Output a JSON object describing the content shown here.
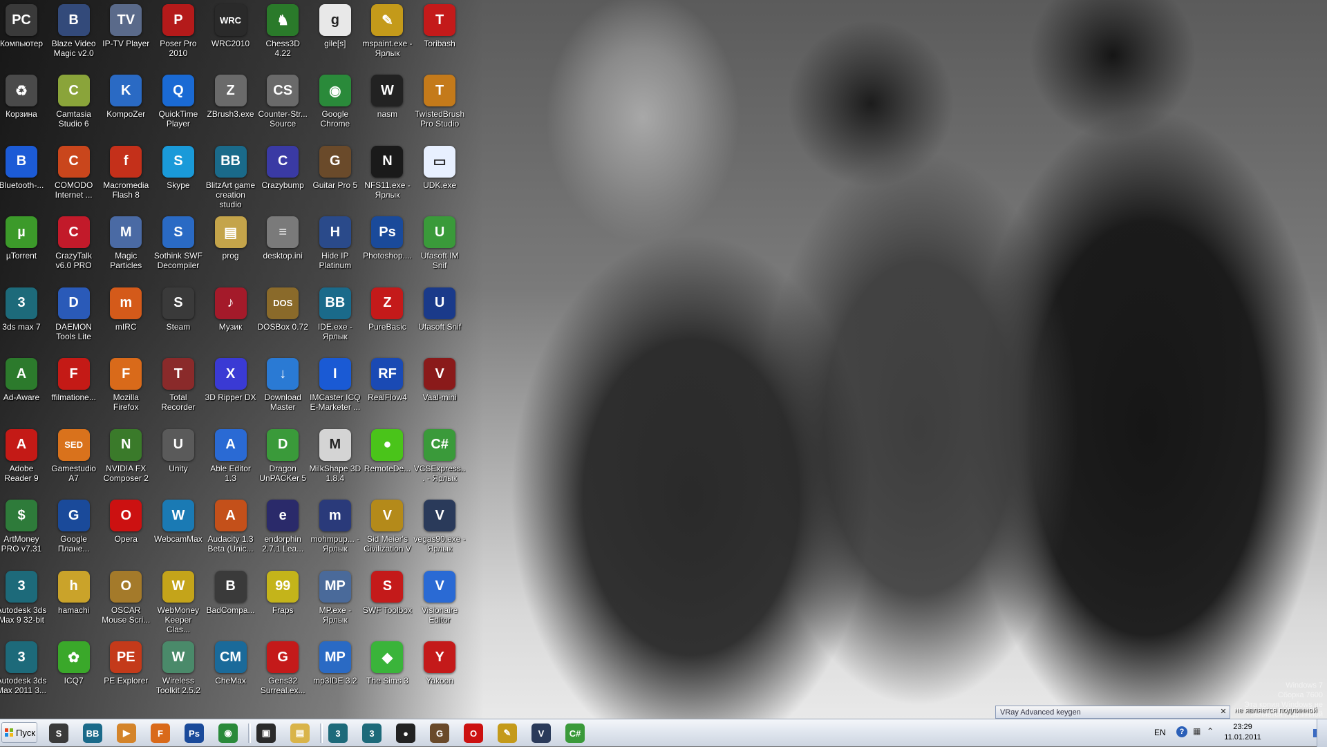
{
  "watermark": [
    "Windows 7",
    "Сборка 7600",
    "Эта копия Windows не является подлинной"
  ],
  "desktop_icons": [
    {
      "label": "Компьютер",
      "color": "#3a3a3a",
      "glyph": "PC"
    },
    {
      "label": "Корзина",
      "color": "#4a4a4a",
      "glyph": "♻"
    },
    {
      "label": "Bluetooth-...",
      "color": "#1c5bd6",
      "glyph": "B"
    },
    {
      "label": "µTorrent",
      "color": "#3c9a2a",
      "glyph": "µ"
    },
    {
      "label": "3ds max 7",
      "color": "#1d6a7a",
      "glyph": "3"
    },
    {
      "label": "Ad-Aware",
      "color": "#2c7a2c",
      "glyph": "A"
    },
    {
      "label": "Adobe Reader 9",
      "color": "#c41a16",
      "glyph": "A"
    },
    {
      "label": "ArtMoney PRO v7.31",
      "color": "#2e7b3a",
      "glyph": "$"
    },
    {
      "label": "Autodesk 3ds Max 9 32-bit",
      "color": "#1d6a7a",
      "glyph": "3"
    },
    {
      "label": "Autodesk 3ds Max 2011 3...",
      "color": "#1d6a7a",
      "glyph": "3"
    },
    {
      "label": "Blaze Video Magic v2.0",
      "color": "#334a7a",
      "glyph": "B"
    },
    {
      "label": "Camtasia Studio 6",
      "color": "#8aa43a",
      "glyph": "C"
    },
    {
      "label": "COMODO Internet ...",
      "color": "#c9461c",
      "glyph": "C"
    },
    {
      "label": "CrazyTalk v6.0 PRO",
      "color": "#c21a2a",
      "glyph": "C"
    },
    {
      "label": "DAEMON Tools Lite",
      "color": "#2a5ab8",
      "glyph": "D"
    },
    {
      "label": "ffilmatione...",
      "color": "#c41a16",
      "glyph": "F"
    },
    {
      "label": "Gamestudio A7",
      "color": "#d9721c",
      "glyph": "SED"
    },
    {
      "label": "Google Плане...",
      "color": "#1a4a9a",
      "glyph": "G"
    },
    {
      "label": "hamachi",
      "color": "#caa32a",
      "glyph": "h"
    },
    {
      "label": "ICQ7",
      "color": "#3aa82a",
      "glyph": "✿"
    },
    {
      "label": "IP-TV Player",
      "color": "#5a6a8a",
      "glyph": "TV"
    },
    {
      "label": "KompoZer",
      "color": "#2a6ac4",
      "glyph": "K"
    },
    {
      "label": "Macromedia Flash 8",
      "color": "#c4301a",
      "glyph": "f"
    },
    {
      "label": "Magic Particles",
      "color": "#4a6aa4",
      "glyph": "M"
    },
    {
      "label": "mIRC",
      "color": "#d45a1a",
      "glyph": "m"
    },
    {
      "label": "Mozilla Firefox",
      "color": "#d96a1a",
      "glyph": "F"
    },
    {
      "label": "NVIDIA FX Composer 2",
      "color": "#3a7a2a",
      "glyph": "N"
    },
    {
      "label": "Opera",
      "color": "#cc1111",
      "glyph": "O"
    },
    {
      "label": "OSCAR Mouse Scri...",
      "color": "#a47a2a",
      "glyph": "O"
    },
    {
      "label": "PE Explorer",
      "color": "#c43a1a",
      "glyph": "PE"
    },
    {
      "label": "Poser Pro 2010",
      "color": "#b41a1a",
      "glyph": "P"
    },
    {
      "label": "QuickTime Player",
      "color": "#1a6ad4",
      "glyph": "Q"
    },
    {
      "label": "Skype",
      "color": "#1a9ad9",
      "glyph": "S"
    },
    {
      "label": "Sothink SWF Decompiler",
      "color": "#2a6ac4",
      "glyph": "S"
    },
    {
      "label": "Steam",
      "color": "#3a3a3a",
      "glyph": "S"
    },
    {
      "label": "Total Recorder",
      "color": "#8a2a2a",
      "glyph": "T"
    },
    {
      "label": "Unity",
      "color": "#5a5a5a",
      "glyph": "U"
    },
    {
      "label": "WebcamMax",
      "color": "#1a7ab4",
      "glyph": "W"
    },
    {
      "label": "WebMoney Keeper Clas...",
      "color": "#c4a41a",
      "glyph": "W"
    },
    {
      "label": "Wireless Toolkit 2.5.2",
      "color": "#4a8a6a",
      "glyph": "W"
    },
    {
      "label": "WRC2010",
      "color": "#2a2a2a",
      "glyph": "WRC"
    },
    {
      "label": "ZBrush3.exe",
      "color": "#6a6a6a",
      "glyph": "Z"
    },
    {
      "label": "BlitzArt game creation studio",
      "color": "#1a6a8a",
      "glyph": "BB"
    },
    {
      "label": "prog",
      "color": "#c4a44a",
      "glyph": "▤"
    },
    {
      "label": "Музик",
      "color": "#a41a2a",
      "glyph": "♪"
    },
    {
      "label": "3D Ripper DX",
      "color": "#3a3ad4",
      "glyph": "X"
    },
    {
      "label": "Able Editor 1.3",
      "color": "#2a6ad4",
      "glyph": "A"
    },
    {
      "label": "Audacity 1.3 Beta (Unic...",
      "color": "#c4501a",
      "glyph": "A"
    },
    {
      "label": "BadCompa...",
      "color": "#3a3a3a",
      "glyph": "B"
    },
    {
      "label": "CheMax",
      "color": "#1a6a9a",
      "glyph": "CM"
    },
    {
      "label": "Chess3D 4.22",
      "color": "#2a7a2a",
      "glyph": "♞"
    },
    {
      "label": "Counter-Str... Source",
      "color": "#6a6a6a",
      "glyph": "CS"
    },
    {
      "label": "Crazybump",
      "color": "#3a3aa4",
      "glyph": "C"
    },
    {
      "label": "desktop.ini",
      "color": "#7a7a7a",
      "glyph": "≡"
    },
    {
      "label": "DOSBox 0.72",
      "color": "#8a6a2a",
      "glyph": "DOS"
    },
    {
      "label": "Download Master",
      "color": "#2a7ad4",
      "glyph": "↓"
    },
    {
      "label": "Dragon UnPACKer 5",
      "color": "#3a9a3a",
      "glyph": "D"
    },
    {
      "label": "endorphin 2.7.1 Lea...",
      "color": "#2a2a6a",
      "glyph": "e"
    },
    {
      "label": "Fraps",
      "color": "#c4b41a",
      "glyph": "99"
    },
    {
      "label": "Gens32 Surreal.ex...",
      "color": "#c41a1a",
      "glyph": "G"
    },
    {
      "label": "gile[s]",
      "color": "#e8e8e8",
      "glyph": "g"
    },
    {
      "label": "Google Chrome",
      "color": "#2a8a3a",
      "glyph": "◉"
    },
    {
      "label": "Guitar Pro 5",
      "color": "#6a4a2a",
      "glyph": "G"
    },
    {
      "label": "Hide IP Platinum",
      "color": "#2a4a8a",
      "glyph": "H"
    },
    {
      "label": "IDE.exe - Ярлык",
      "color": "#1a6a8a",
      "glyph": "BB"
    },
    {
      "label": "IMCaster ICQ E-Marketer ...",
      "color": "#1a5ad4",
      "glyph": "I"
    },
    {
      "label": "MilkShape 3D 1.8.4",
      "color": "#d4d4d4",
      "glyph": "M"
    },
    {
      "label": "mohmpup... - Ярлык",
      "color": "#2a3a7a",
      "glyph": "m"
    },
    {
      "label": "MP.exe - Ярлык",
      "color": "#4a6a9a",
      "glyph": "MP"
    },
    {
      "label": "mp3IDE 3.2",
      "color": "#2a6ac4",
      "glyph": "MP"
    },
    {
      "label": "mspaint.exe - Ярлык",
      "color": "#c49a1a",
      "glyph": "✎"
    },
    {
      "label": "nasm",
      "color": "#222222",
      "glyph": "W"
    },
    {
      "label": "NFS11.exe - Ярлык",
      "color": "#1a1a1a",
      "glyph": "N"
    },
    {
      "label": "Photoshop....",
      "color": "#1a4a9a",
      "glyph": "Ps"
    },
    {
      "label": "PureBasic",
      "color": "#c41a1a",
      "glyph": "Z"
    },
    {
      "label": "RealFlow4",
      "color": "#1a4ab4",
      "glyph": "RF"
    },
    {
      "label": "RemoteDe...",
      "color": "#4ac41a",
      "glyph": "●"
    },
    {
      "label": "Sid Meier's Civilization V",
      "color": "#b48a1a",
      "glyph": "V"
    },
    {
      "label": "SWF Toolbox",
      "color": "#c41a1a",
      "glyph": "S"
    },
    {
      "label": "The Sims 3",
      "color": "#3ab43a",
      "glyph": "◆"
    },
    {
      "label": "Toribash",
      "color": "#c41a1a",
      "glyph": "T"
    },
    {
      "label": "TwistedBrush Pro Studio",
      "color": "#c47a1a",
      "glyph": "T"
    },
    {
      "label": "UDK.exe",
      "color": "#e8f0ff",
      "glyph": "▭"
    },
    {
      "label": "Ufasoft IM Snif",
      "color": "#3a9a3a",
      "glyph": "U"
    },
    {
      "label": "Ufasoft Snif",
      "color": "#1a3a8a",
      "glyph": "U"
    },
    {
      "label": "Vaal-mini",
      "color": "#8a1a1a",
      "glyph": "V"
    },
    {
      "label": "VCSExpress... - Ярлык",
      "color": "#3a9a3a",
      "glyph": "C#"
    },
    {
      "label": "vegas90.exe - Ярлык",
      "color": "#2a3a5a",
      "glyph": "V"
    },
    {
      "label": "Visionaire Editor",
      "color": "#2a6ad4",
      "glyph": "V"
    },
    {
      "label": "Yakoon",
      "color": "#c41a1a",
      "glyph": "Y"
    }
  ],
  "vray_bar": {
    "text": "VRay Advanced keygen",
    "note": "не является подлинной"
  },
  "taskbar": {
    "start_label": "Пуск",
    "buttons": [
      {
        "name": "steam",
        "color": "#3a3a3a",
        "glyph": "S"
      },
      {
        "name": "blitz",
        "color": "#1a6a8a",
        "glyph": "BB"
      },
      {
        "name": "media-player",
        "color": "#d4842a",
        "glyph": "▶"
      },
      {
        "name": "firefox",
        "color": "#d96a1a",
        "glyph": "F"
      },
      {
        "name": "photoshop",
        "color": "#1a4a9a",
        "glyph": "Ps"
      },
      {
        "name": "chrome",
        "color": "#2a8a3a",
        "glyph": "◉"
      },
      {
        "name": "terminal",
        "color": "#2a2a2a",
        "glyph": "▣"
      },
      {
        "name": "explorer",
        "color": "#d9b44a",
        "glyph": "▤"
      },
      {
        "name": "3dsmax-1",
        "color": "#1d6a7a",
        "glyph": "3"
      },
      {
        "name": "3dsmax-2",
        "color": "#1d6a7a",
        "glyph": "3"
      },
      {
        "name": "alien",
        "color": "#222222",
        "glyph": "●"
      },
      {
        "name": "guitar-pro",
        "color": "#6a4a2a",
        "glyph": "G"
      },
      {
        "name": "opera",
        "color": "#cc1111",
        "glyph": "O"
      },
      {
        "name": "mspaint",
        "color": "#c49a1a",
        "glyph": "✎"
      },
      {
        "name": "vegas",
        "color": "#2a3a5a",
        "glyph": "V"
      },
      {
        "name": "vcsexpress",
        "color": "#3a9a3a",
        "glyph": "C#"
      }
    ],
    "lang": "EN",
    "time": "23:29",
    "date": "11.01.2011"
  }
}
